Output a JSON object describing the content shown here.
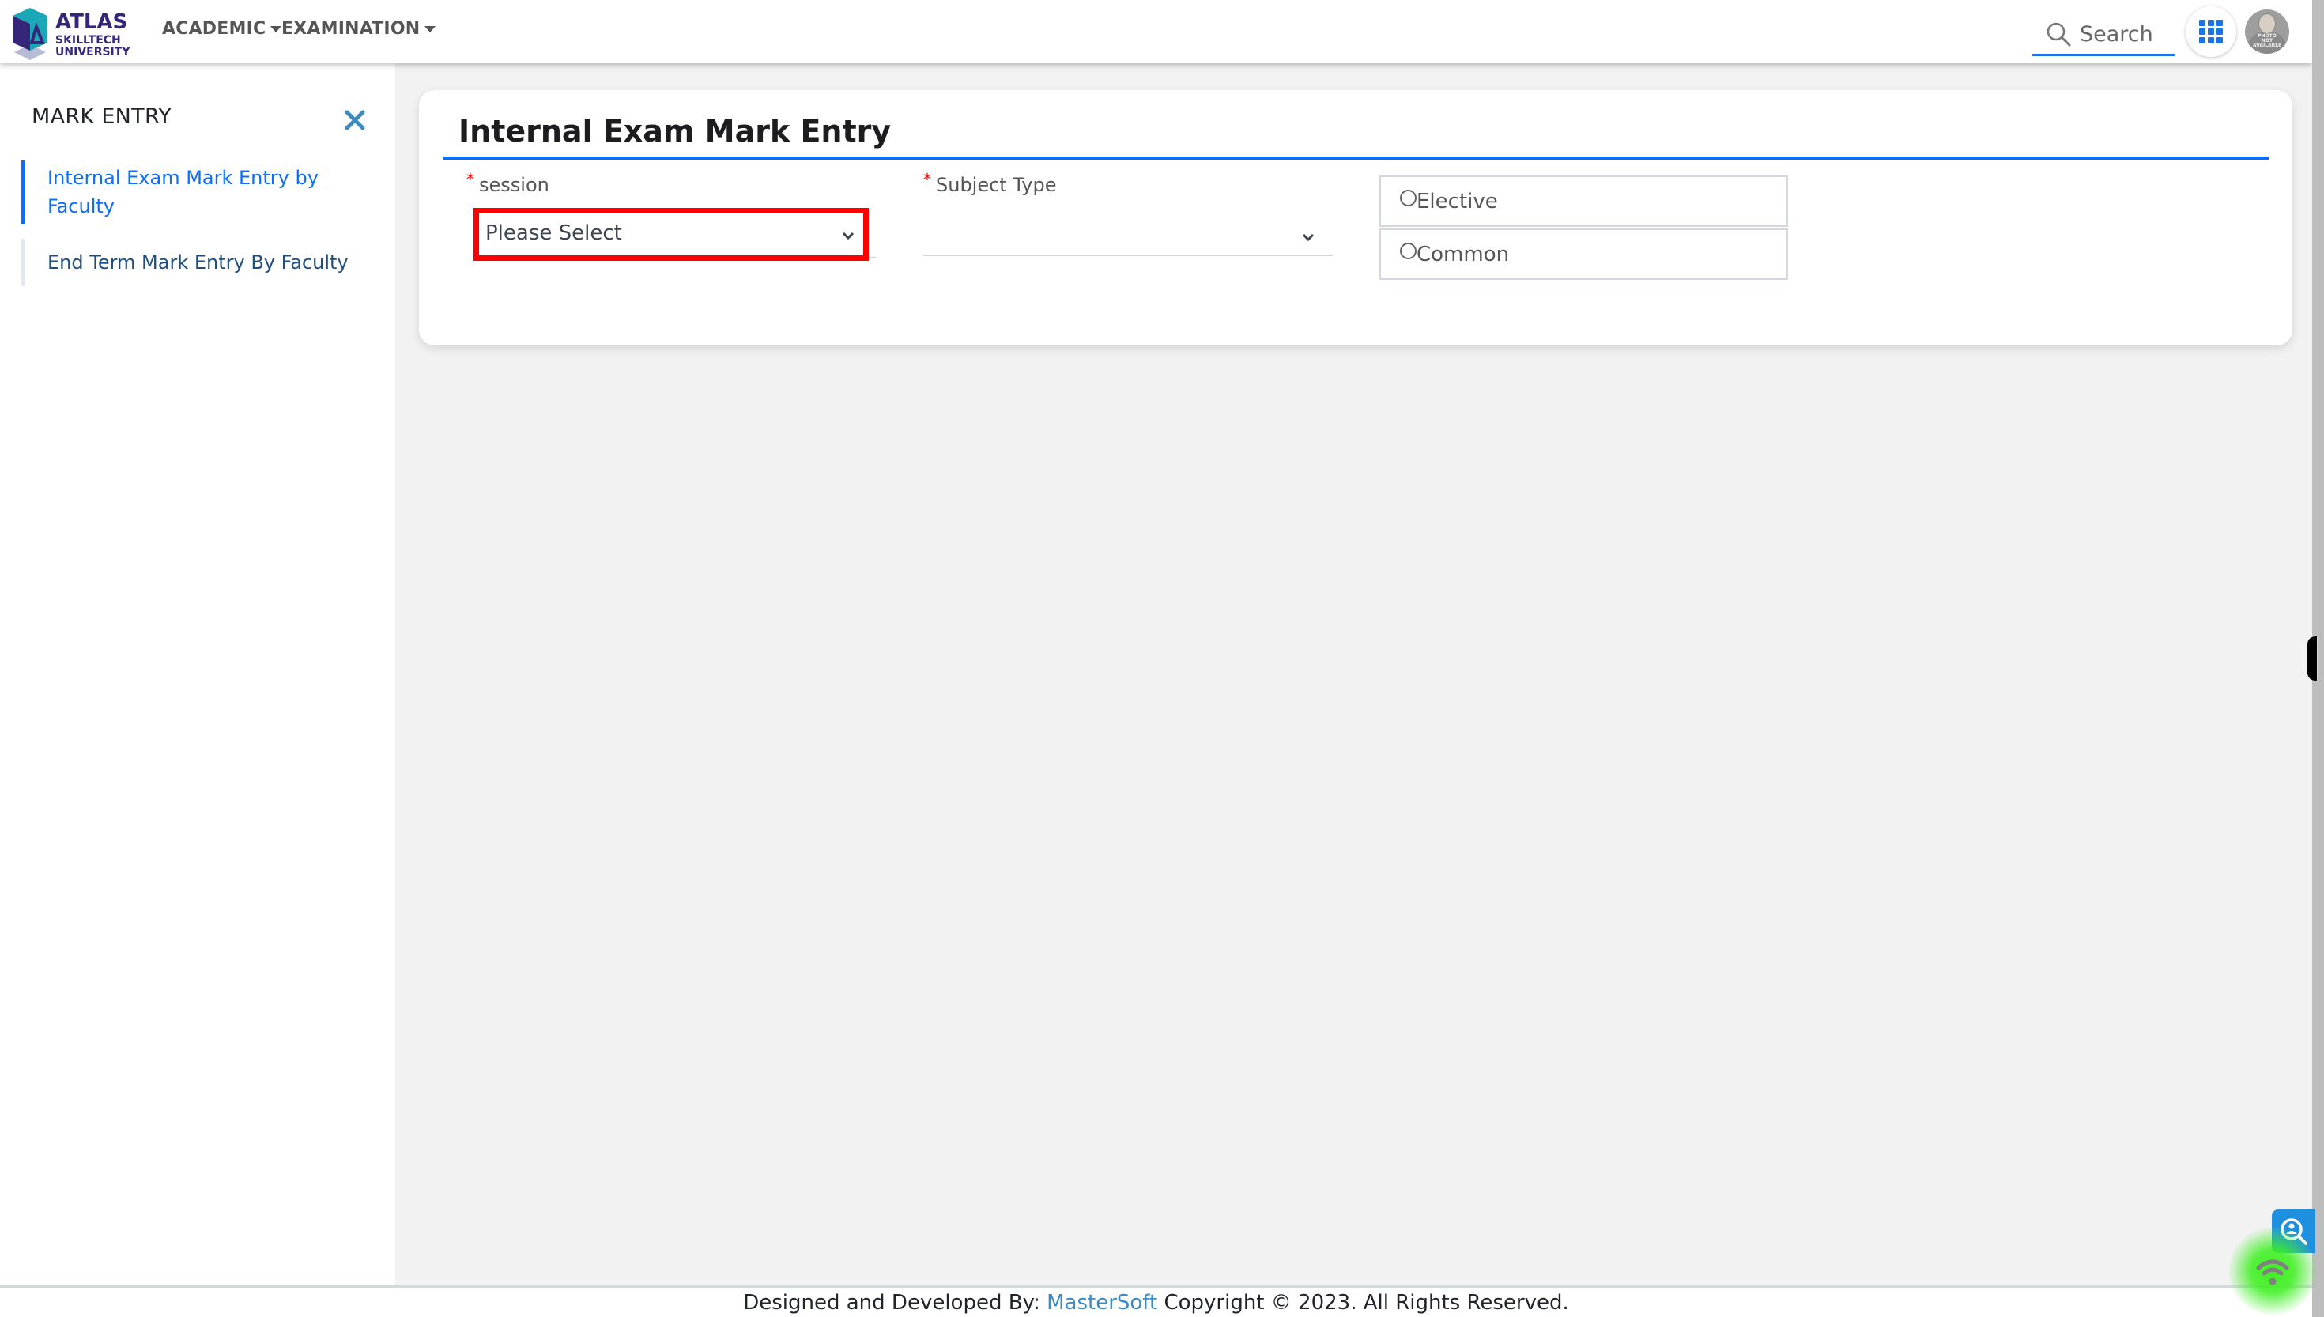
{
  "header": {
    "logo": {
      "line1": "ATLAS",
      "line2": "SKILLTECH",
      "line3": "UNIVERSITY"
    },
    "menus": [
      {
        "label": "ACADEMIC"
      },
      {
        "label": "EXAMINATION"
      }
    ],
    "search": {
      "placeholder": "Search",
      "icon": "search-icon"
    },
    "apps_icon": "apps-grid-icon",
    "avatar": {
      "text": [
        "PHOTO",
        "NOT",
        "AVAILABLE"
      ]
    }
  },
  "sidebar": {
    "title": "MARK ENTRY",
    "close_icon": "close-icon",
    "items": [
      {
        "label": "Internal Exam Mark Entry by Faculty",
        "active": true
      },
      {
        "label": "End Term Mark Entry By Faculty",
        "active": false
      }
    ]
  },
  "main": {
    "title": "Internal Exam Mark Entry",
    "fields": {
      "session": {
        "label": "session",
        "required_mark": "*",
        "value": "Please Select"
      },
      "subject_type": {
        "label": "Subject Type",
        "required_mark": "*",
        "value": ""
      }
    },
    "radio_options": [
      {
        "label": "Elective",
        "checked": false
      },
      {
        "label": "Common",
        "checked": false
      }
    ]
  },
  "footer": {
    "prefix": "Designed and Developed By:",
    "brand": "MasterSoft",
    "suffix": "Copyright © 2023. All Rights Reserved."
  },
  "colors": {
    "accent": "#0d6efd",
    "highlight_border": "#ff0000",
    "logo_navy": "#35267a",
    "logo_teal": "#1aa7b8"
  }
}
